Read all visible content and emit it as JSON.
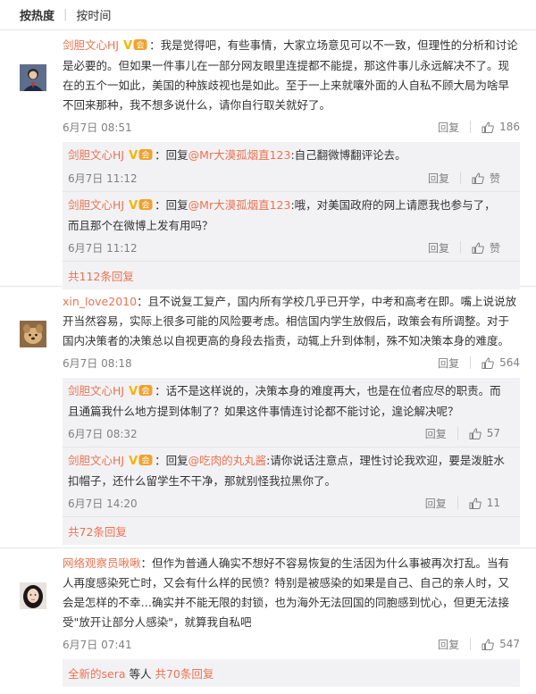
{
  "sort": {
    "hot": "按热度",
    "time": "按时间"
  },
  "comments": [
    {
      "user": "剑胆文心HJ",
      "text": "：我是觉得吧，有些事情，大家立场意见可以不一致，但理性的分析和讨论是必要的。但如果一件事儿在一部分网友眼里连提都不能提，那这件事儿永远解决不了。现在的五个一如此，美国的种族歧视也是如此。至于一上来就嚷外面的人自私不顾大局为啥早不回来那种，我不想多说什么，请你自行取关就好了。",
      "time": "6月7日 08:51",
      "reply_label": "回复",
      "likes": "186",
      "replies": [
        {
          "user": "剑胆文心HJ",
          "prefix": "：回复",
          "mention": "@Mr大漠孤烟直123",
          "text": ":自己翻微博翻评论去。",
          "time": "6月7日 11:12",
          "reply_label": "回复",
          "likes": "赞"
        },
        {
          "user": "剑胆文心HJ",
          "prefix": "：回复",
          "mention": "@Mr大漠孤烟直123",
          "text": ":哦，对美国政府的网上请愿我也参与了，而且那个在微博上发有用吗？",
          "time": "6月7日 11:12",
          "reply_label": "回复",
          "likes": "赞"
        }
      ],
      "more": "共112条回复"
    },
    {
      "user": "xin_love2010",
      "text": "：且不说复工复产，国内所有学校几乎已开学，中考和高考在即。嘴上说说放开当然容易，实际上很多可能的风险要考虑。相信国内学生放假后，政策会有所调整。对于国内决策者的决策总以自视更高的身段去指责，动辄上升到体制，殊不知决策本身的难度。",
      "time": "6月7日 08:18",
      "reply_label": "回复",
      "likes": "564",
      "replies": [
        {
          "user": "剑胆文心HJ",
          "prefix": "：话不是这样说的，决策本身的难度再大，也是在位者应尽的职责。而且通篇我什么地方提到体制了？如果这件事情连讨论都不能讨论，遑论解决呢？",
          "mention": "",
          "text": "",
          "time": "6月7日 08:32",
          "reply_label": "回复",
          "likes": "57"
        },
        {
          "user": "剑胆文心HJ",
          "prefix": "：回复",
          "mention": "@吃肉的丸丸酱",
          "text": ":请你说话注意点，理性讨论我欢迎，要是泼脏水扣帽子，还什么留学生不干净，那就别怪我拉黑你了。",
          "time": "6月7日 14:20",
          "reply_label": "回复",
          "likes": "11"
        }
      ],
      "more": "共72条回复"
    },
    {
      "user": "网络观察员啾啾",
      "text": "：但作为普通人确实不想好不容易恢复的生活因为什么事被再次打乱。当有人再度感染死亡时，又会有什么样的民愤？特别是被感染的如果是自己、自己的亲人时，又会是怎样的不幸…确实并不能无限的封锁，也为海外无法回国的同胞感到忧心，但更无法接受\"放开让部分人感染\"，就算我自私吧",
      "time": "6月7日 07:41",
      "reply_label": "回复",
      "likes": "547",
      "replies": [],
      "more_user": "全新的sera",
      "more_mid": " 等人 ",
      "more": "共70条回复"
    }
  ]
}
